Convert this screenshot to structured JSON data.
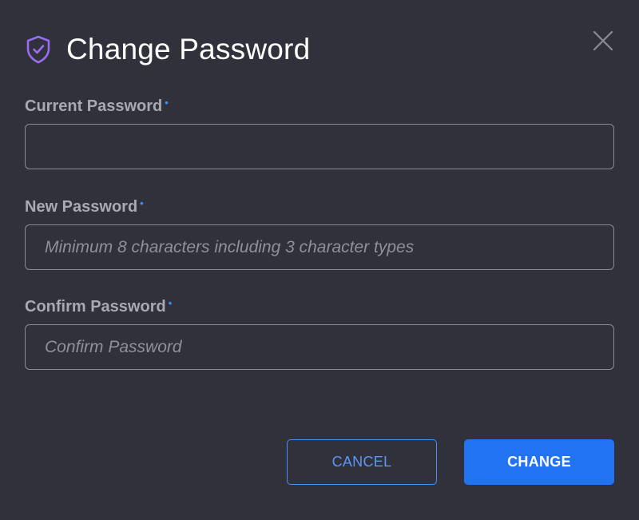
{
  "dialog": {
    "title": "Change Password",
    "accent_color": "#9a6cf0",
    "title_icon": "shield-check-icon",
    "close_icon": "close-icon"
  },
  "fields": {
    "current_password": {
      "label": "Current Password",
      "required_marker": "•",
      "value": "",
      "placeholder": ""
    },
    "new_password": {
      "label": "New Password",
      "required_marker": "•",
      "value": "",
      "placeholder": "Minimum 8 characters including 3 character types"
    },
    "confirm_password": {
      "label": "Confirm Password",
      "required_marker": "•",
      "value": "",
      "placeholder": "Confirm Password"
    }
  },
  "actions": {
    "cancel_label": "CANCEL",
    "change_label": "CHANGE",
    "primary_color": "#2273f2"
  }
}
